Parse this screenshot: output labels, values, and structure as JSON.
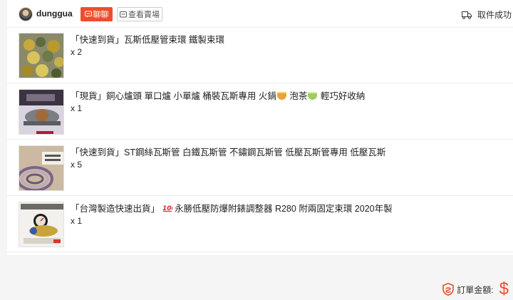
{
  "shop": {
    "name": "dunggua",
    "chat_label": "聊聊",
    "view_shop_label": "查看賣場",
    "status": "取件成功"
  },
  "items": [
    {
      "title": "「快速到貨」瓦斯低壓管束環 鐵製束環",
      "qty": "x 2"
    },
    {
      "title_a": "「現貨」銅心爐頭 單口爐 小單爐 桶裝瓦斯專用 火鍋",
      "title_b": "泡茶",
      "title_c": "輕巧好收納",
      "qty": "x 1"
    },
    {
      "title": "「快速到貨」ST鋼絲瓦斯管 白鐵瓦斯管 不鏽鋼瓦斯管 低壓瓦斯管專用 低壓瓦斯",
      "qty": "x 5"
    },
    {
      "title_a": "「台灣製造快速出貨」",
      "title_b": "永勝低壓防爆附錶調整器 R280 附兩固定束環 2020年製",
      "qty": "x 1"
    }
  ],
  "footer": {
    "total_label": "訂單金額:",
    "currency": "$"
  },
  "colors": {
    "accent": "#ee4d2d"
  },
  "icons": [
    "chat-icon",
    "shop-icon",
    "truck-icon",
    "shield-icon",
    "pot-emoji-icon",
    "tea-emoji-icon",
    "hundred-emoji-icon"
  ]
}
